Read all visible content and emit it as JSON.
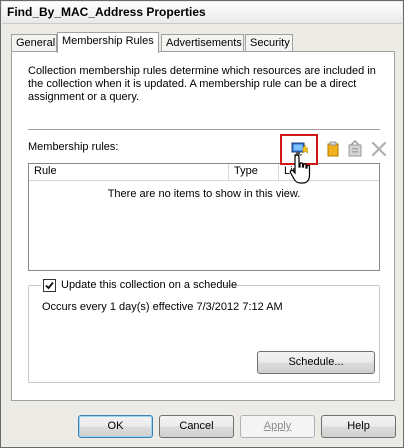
{
  "window": {
    "title": "Find_By_MAC_Address Properties"
  },
  "tabs": [
    {
      "label": "General",
      "active": false
    },
    {
      "label": "Membership Rules",
      "active": true
    },
    {
      "label": "Advertisements",
      "active": false
    },
    {
      "label": "Security",
      "active": false
    }
  ],
  "panel": {
    "description": "Collection membership rules determine which resources are included in the collection when it is updated. A membership rule can be a direct assignment or a query.",
    "rules_label": "Membership rules:",
    "toolbar": {
      "icons": [
        "new-query-rule-icon",
        "direct-rule-icon",
        "properties-icon",
        "delete-icon"
      ],
      "highlight_color": "#d01818"
    },
    "list": {
      "columns": [
        "Rule",
        "Type",
        "Limit"
      ],
      "empty_text": "There are no items to show in this view."
    },
    "schedule": {
      "checkbox_label": "Update this collection on a schedule",
      "checked": true,
      "text": "Occurs every 1 day(s) effective 7/3/2012 7:12 AM",
      "button_label": "Schedule..."
    }
  },
  "footer": {
    "ok": "OK",
    "cancel": "Cancel",
    "apply": "Apply",
    "help": "Help"
  }
}
